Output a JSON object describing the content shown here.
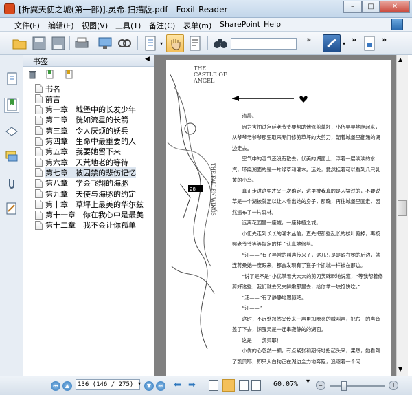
{
  "window": {
    "title": "[折翼天使之城(第一部)].灵希.扫描版.pdf - Foxit Reader",
    "minimize": "–",
    "maximize": "□",
    "close": "✕"
  },
  "menu": [
    "文件(F)",
    "编辑(E)",
    "视图(V)",
    "工具(T)",
    "备注(C)",
    "表单(m)",
    "SharePoint",
    "Help"
  ],
  "toolbar": {
    "search_placeholder": ""
  },
  "panel": {
    "title": "书签",
    "bookmarks": [
      {
        "label": "书名"
      },
      {
        "label": "前言"
      },
      {
        "label": "第一章　城堡中的长发少年"
      },
      {
        "label": "第二章　恍如流星的长箭"
      },
      {
        "label": "第三章　令人厌烦的妖兵"
      },
      {
        "label": "第四章　生命中最重要的人"
      },
      {
        "label": "第五章　我要她留下来"
      },
      {
        "label": "第六章　天荒地老的等待"
      },
      {
        "label": "第七章　被囚禁的悲伤记忆"
      },
      {
        "label": "第八章　学会飞翔的海豚"
      },
      {
        "label": "第九章　天使与海豚的约定"
      },
      {
        "label": "第十章　草坪上最美的华尔兹"
      },
      {
        "label": "第十一章　你在我心中是最美"
      },
      {
        "label": "第十二章　我不会让你孤单"
      }
    ],
    "selected_index": 8
  },
  "document": {
    "art_title_line1": "THE",
    "art_title_line2": "CASTLE OF",
    "art_title_line3": "ANGEL",
    "art_side_text": "THE FALLEN WINGS",
    "page_number": "28",
    "paragraphs": [
      "清晨。",
      "因为害怕过宫廷老爷爷要帮助他修剪草坪，小伍早早地爬起来，从爷爷老爷爷那里取来专门修剪草坪的大剪刀，朝着城堡里翻涌的湖边走去。",
      "空气中的湿气还没有散去，伏美的湖面上，浮着一层淡淡的水汽，环绕湖面的是一片绿草和灌木。远处，竟然挂着可以看到几只乳黄的小鸟。",
      "真正走进这里才又一次确定，这里被我真的是人猛过的，不要说草是一个湖被就足以让人看出她的身子，那晚，再往城堡里面走，因然遍布了一片森林。",
      "远离花园里一座城，一座种植之城。",
      "小伍先走到长长的灌木丛前，直先把那些乱长的枝叶剪掉，再按照老爷爷等等规定的样子认真地修剪。",
      "“汪——”有了异常的叫声传来了，这几只是是跟在她的后边，就连蒋桑她一度跟来，都会发现有了猴子个抓城一样被在那边。",
      "“说了是不是”小优掌着大大大的剪刀笑眯眯地说道，“等我帮着修剪好这些，我们就去叉夹鲜嫩那里去，给你拿一块馅饼吃。”",
      "“汪——”有了静静地跟随吧。",
      "“汪——”",
      "这时，不远处忽然又传来一声更加嘹亮的喊叫声，把布丁的声音盖了下去，惊醒灵是一连串寂静的的湖面。",
      "这是——凯贝耶！",
      "小优的心忽然一颤，有点紧张和期待地抬起头来，果然，她看到了凯贝耶，即只大白狗正在湖边全力地奔跑，追逐着一个闪"
    ]
  },
  "status": {
    "page_input": "136 (146 / 275)",
    "zoom": "60.07%"
  }
}
